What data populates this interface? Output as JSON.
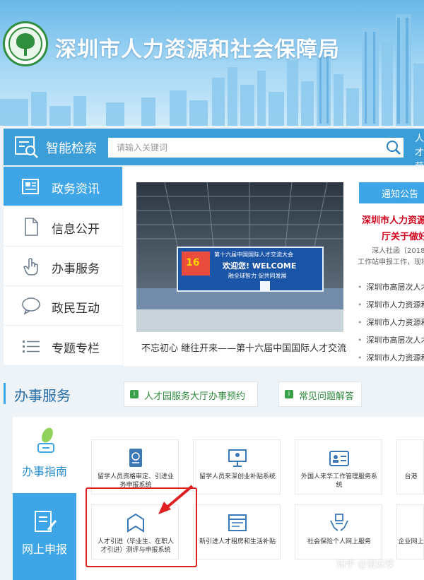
{
  "header": {
    "title": "深圳市人力资源和社会保障局",
    "emblem_text": "深圳市人力资源和社会保障局"
  },
  "search": {
    "label": "智能检索",
    "placeholder": "请输入关键词",
    "hotwords": "人才 劳动"
  },
  "nav": {
    "items": [
      {
        "label": "政务资讯",
        "icon": "newspaper-icon",
        "active": true
      },
      {
        "label": "信息公开",
        "icon": "document-icon",
        "active": false
      },
      {
        "label": "办事服务",
        "icon": "hand-pointer-icon",
        "active": false
      },
      {
        "label": "政民互动",
        "icon": "chat-bubble-icon",
        "active": false
      },
      {
        "label": "专题专栏",
        "icon": "list-icon",
        "active": false
      }
    ]
  },
  "news": {
    "caption": "不忘初心 继往开来——第十六届中国国际人才交流",
    "banner_title": "第十六届中国国际人才交流大会",
    "banner_welcome": "欢迎您! WELCOME",
    "banner_slogan": "融全球智力  促共同发展",
    "banner_badge": "16"
  },
  "notice": {
    "tab": "通知公告",
    "headline1": "深圳市人力资源",
    "headline2": "厅关于做好",
    "sub1": "深人社函〔2018",
    "sub2": "工作站申报工作，现将",
    "items": [
      "深圳市高层次人才",
      "深圳市人力资源和",
      "深圳市人力资源和",
      "深圳市高层次人才",
      "深圳市人力资源和"
    ]
  },
  "services": {
    "title": "办事服务",
    "quick_buttons": [
      "人才园服务大厅办事预约",
      "常见问题解答"
    ],
    "tab_guide": "办事指南",
    "tab_online": "网上申报",
    "row1": [
      {
        "label1": "留学人员资格审定、引进业",
        "label2": "务申报系统",
        "icon": "passport-icon"
      },
      {
        "label1": "留学人员来深创业补贴系统",
        "label2": "",
        "icon": "presentation-icon"
      },
      {
        "label1": "外国人来华工作管理服务系",
        "label2": "统",
        "icon": "id-card-icon"
      },
      {
        "label1": "台港",
        "label2": "",
        "icon": "globe-icon"
      }
    ],
    "row2": [
      {
        "label1": "人才引进（毕业生、在职人",
        "label2": "才引进）测评与申报系统",
        "icon": "bookmark-house-icon"
      },
      {
        "label1": "新引进人才租房和生活补贴",
        "label2": "",
        "icon": "window-list-icon"
      },
      {
        "label1": "社会保险个人网上服务",
        "label2": "",
        "icon": "hands-people-icon"
      },
      {
        "label1": "企业网上",
        "label2": "",
        "icon": "building-icon"
      }
    ]
  },
  "watermark": "知乎 @蜜妖孽",
  "colors": {
    "primary": "#3ea6e6",
    "header_blue": "#6ab8e8",
    "notice_red": "#d0021b",
    "highlight_red": "#e02020",
    "quick_green": "#3aa14a"
  }
}
